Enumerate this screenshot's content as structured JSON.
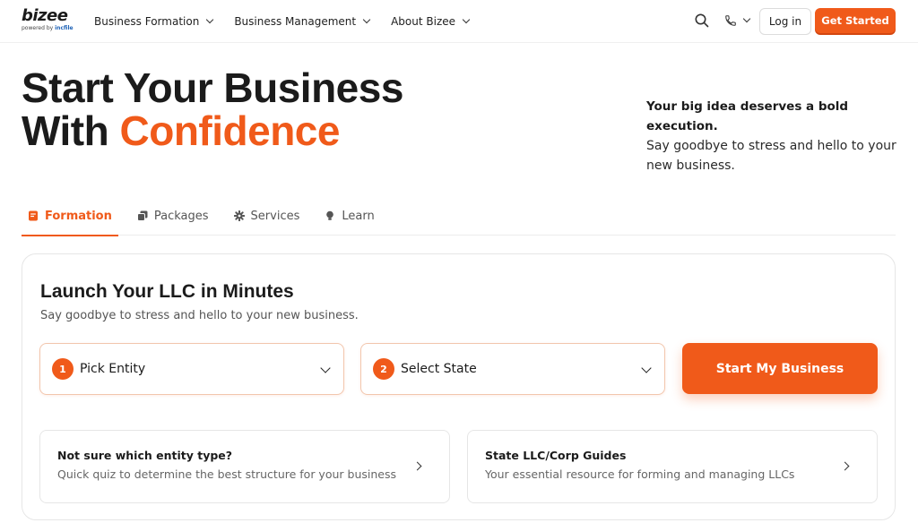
{
  "header": {
    "logo_text": "bizee",
    "logo_sub_prefix": "powered by",
    "logo_sub_brand": "incfile",
    "nav": [
      {
        "label": "Business Formation"
      },
      {
        "label": "Business Management"
      },
      {
        "label": "About Bizee"
      }
    ],
    "login_label": "Log in",
    "get_started_label": "Get Started"
  },
  "hero": {
    "title_line1": "Start Your Business",
    "title_line2_plain": "With ",
    "title_line2_accent": "Confidence",
    "side_bold": "Your big idea deserves a bold execution.",
    "side_text": "Say goodbye to stress and hello to your new business."
  },
  "tabs": [
    {
      "label": "Formation",
      "icon": "document-icon",
      "active": true
    },
    {
      "label": "Packages",
      "icon": "stack-icon",
      "active": false
    },
    {
      "label": "Services",
      "icon": "gear-icon",
      "active": false
    },
    {
      "label": "Learn",
      "icon": "lightbulb-icon",
      "active": false
    }
  ],
  "card": {
    "title": "Launch Your LLC in Minutes",
    "subtitle": "Say goodbye to stress and hello to your new business.",
    "step1": {
      "number": "1",
      "label": "Pick Entity"
    },
    "step2": {
      "number": "2",
      "label": "Select State"
    },
    "cta_label": "Start My Business",
    "info": [
      {
        "title": "Not sure which entity type?",
        "desc": "Quick quiz to determine the best structure for your business"
      },
      {
        "title": "State LLC/Corp Guides",
        "desc": "Your essential resource for forming and managing LLCs"
      }
    ]
  },
  "colors": {
    "accent": "#f05a1a",
    "text": "#1b1b1b",
    "muted": "#555555",
    "border": "#e6e6e6"
  }
}
